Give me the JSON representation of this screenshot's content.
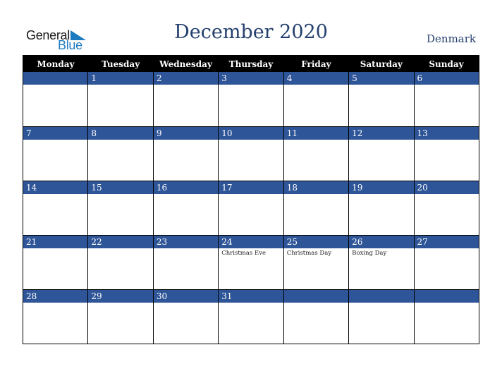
{
  "logo": {
    "text_general": "General",
    "text_blue": "Blue",
    "icon": "triangle-flag-icon",
    "brand_color": "#1f7bc0"
  },
  "title": "December 2020",
  "country": "Denmark",
  "colors": {
    "title": "#25406e",
    "header_bg": "#000000",
    "day_bar": "#2e5597"
  },
  "weekdays": [
    "Monday",
    "Tuesday",
    "Wednesday",
    "Thursday",
    "Friday",
    "Saturday",
    "Sunday"
  ],
  "weeks": [
    [
      {
        "day": ""
      },
      {
        "day": "1"
      },
      {
        "day": "2"
      },
      {
        "day": "3"
      },
      {
        "day": "4"
      },
      {
        "day": "5"
      },
      {
        "day": "6"
      }
    ],
    [
      {
        "day": "7"
      },
      {
        "day": "8"
      },
      {
        "day": "9"
      },
      {
        "day": "10"
      },
      {
        "day": "11"
      },
      {
        "day": "12"
      },
      {
        "day": "13"
      }
    ],
    [
      {
        "day": "14"
      },
      {
        "day": "15"
      },
      {
        "day": "16"
      },
      {
        "day": "17"
      },
      {
        "day": "18"
      },
      {
        "day": "19"
      },
      {
        "day": "20"
      }
    ],
    [
      {
        "day": "21"
      },
      {
        "day": "22"
      },
      {
        "day": "23"
      },
      {
        "day": "24",
        "holiday": "Christmas Eve"
      },
      {
        "day": "25",
        "holiday": "Christmas Day"
      },
      {
        "day": "26",
        "holiday": "Boxing Day"
      },
      {
        "day": "27"
      }
    ],
    [
      {
        "day": "28"
      },
      {
        "day": "29"
      },
      {
        "day": "30"
      },
      {
        "day": "31"
      },
      {
        "day": ""
      },
      {
        "day": ""
      },
      {
        "day": ""
      }
    ]
  ]
}
